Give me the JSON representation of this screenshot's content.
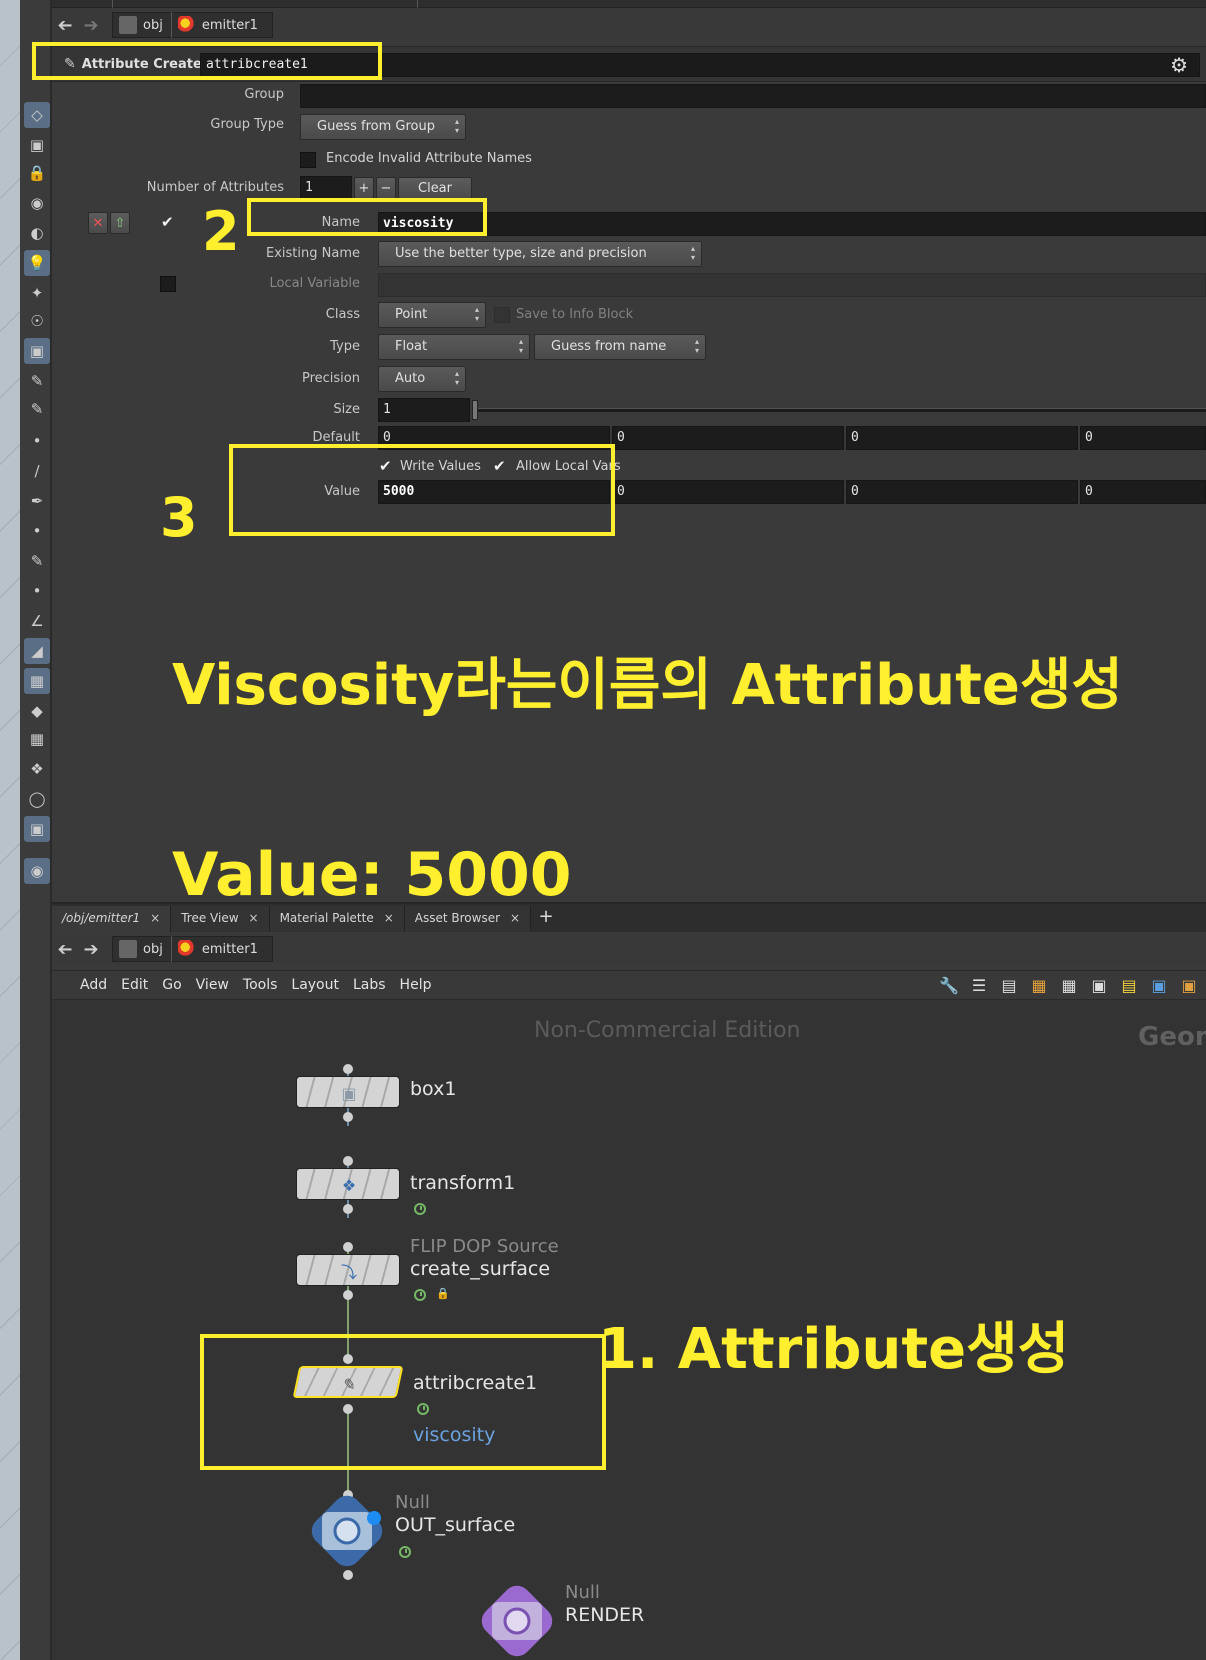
{
  "colors": {
    "annotation": "#ffef2e",
    "attr_text": "#6aa2e0",
    "null_blue": "#3c6aa8",
    "null_purple": "#9a6ad0"
  },
  "top_path": {
    "root": "obj",
    "node": "emitter1"
  },
  "param_header": {
    "type_label": "Attribute Create",
    "node_name": "attribcreate1",
    "settings_icon": "gear-icon"
  },
  "params": {
    "group_label": "Group",
    "group_value": "",
    "group_type_label": "Group Type",
    "group_type_value": "Guess from Group",
    "encode_label": "Encode Invalid Attribute Names",
    "encode_checked": false,
    "num_attr_label": "Number of Attributes",
    "num_attr_value": "1",
    "plus": "+",
    "minus": "−",
    "clear_label": "Clear",
    "name_label": "Name",
    "name_value": "viscosity",
    "existing_name_label": "Existing Name",
    "existing_name_value": "Use the better type, size and precision",
    "local_var_label": "Local Variable",
    "class_label": "Class",
    "class_value": "Point",
    "save_info_label": "Save to Info Block",
    "type_label": "Type",
    "type_value": "Float",
    "type_guess_value": "Guess from name",
    "precision_label": "Precision",
    "precision_value": "Auto",
    "size_label": "Size",
    "size_value": "1",
    "default_label": "Default",
    "default_values": [
      "0",
      "0",
      "0",
      "0"
    ],
    "write_values_label": "Write Values",
    "allow_local_vars_label": "Allow Local Vars",
    "value_label": "Value",
    "value_values": [
      "5000",
      "0",
      "0",
      "0"
    ]
  },
  "annotations": {
    "num2": "2",
    "num3": "3",
    "headline": "Viscosity라는이름의 Attribute생성",
    "value_note": "Value: 5000",
    "step1": "1. Attribute생성"
  },
  "tabs": [
    {
      "label": "/obj/emitter1",
      "close": "×"
    },
    {
      "label": "Tree View",
      "close": "×"
    },
    {
      "label": "Material Palette",
      "close": "×"
    },
    {
      "label": "Asset Browser",
      "close": "×"
    }
  ],
  "tab_add": "+",
  "bottom_path": {
    "root": "obj",
    "node": "emitter1"
  },
  "menubar": [
    "Add",
    "Edit",
    "Go",
    "View",
    "Tools",
    "Layout",
    "Labs",
    "Help"
  ],
  "network": {
    "watermark": "Non-Commercial Edition",
    "context_label": "Geom",
    "nodes": {
      "box": {
        "name": "box1"
      },
      "transform": {
        "name": "transform1"
      },
      "source": {
        "type": "FLIP DOP Source",
        "name": "create_surface"
      },
      "attribcreate": {
        "name": "attribcreate1",
        "attr": "viscosity"
      },
      "out": {
        "type": "Null",
        "name": "OUT_surface"
      },
      "render": {
        "type": "Null",
        "name": "RENDER"
      }
    }
  }
}
